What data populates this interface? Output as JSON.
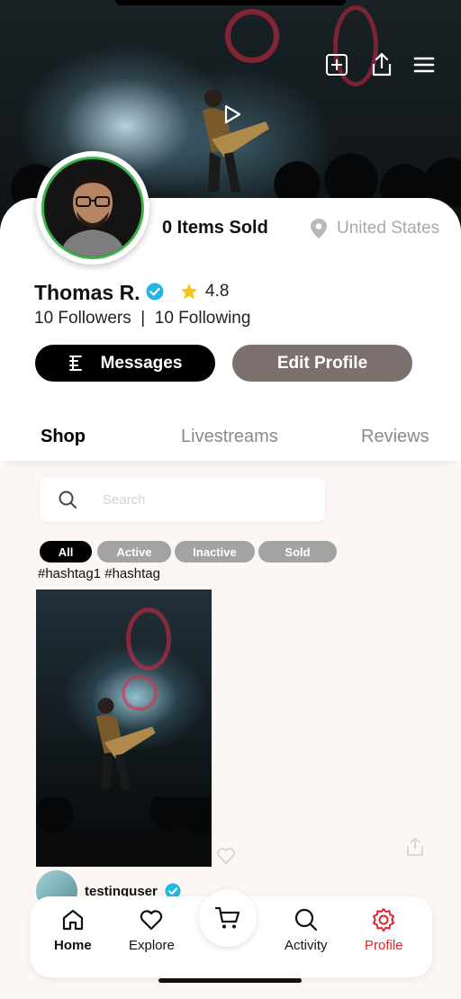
{
  "profile": {
    "name": "Thomas R.",
    "rating": "4.8",
    "followers_text": "10 Followers  |  10 Following",
    "items_sold": "0 Items Sold",
    "location": "United States"
  },
  "buttons": {
    "messages": "Messages",
    "edit_profile": "Edit Profile"
  },
  "tabs": [
    {
      "label": "Shop",
      "active": true
    },
    {
      "label": "Livestreams",
      "active": false
    },
    {
      "label": "Reviews",
      "active": false
    }
  ],
  "search": {
    "placeholder": "Search"
  },
  "filters": [
    {
      "label": "All",
      "selected": true
    },
    {
      "label": "Active",
      "selected": false
    },
    {
      "label": "Inactive",
      "selected": false
    },
    {
      "label": "Sold",
      "selected": false
    }
  ],
  "post": {
    "hashtags": "#hashtag1 #hashtag",
    "username": "testinguser",
    "avatar_badge": "prime"
  },
  "nav": [
    {
      "label": "Home",
      "icon": "home-icon"
    },
    {
      "label": "Explore",
      "icon": "heart-icon"
    },
    {
      "label": "",
      "icon": "cart-icon"
    },
    {
      "label": "Activity",
      "icon": "search-icon"
    },
    {
      "label": "Profile",
      "icon": "gear-icon"
    }
  ],
  "colors": {
    "verified": "#23b6e6",
    "star": "#f5c518",
    "avatar_ring": "#3bb54a",
    "profile_active": "#e0252a",
    "edit_button": "#7b706e",
    "chip_inactive": "#a3a3a3"
  }
}
